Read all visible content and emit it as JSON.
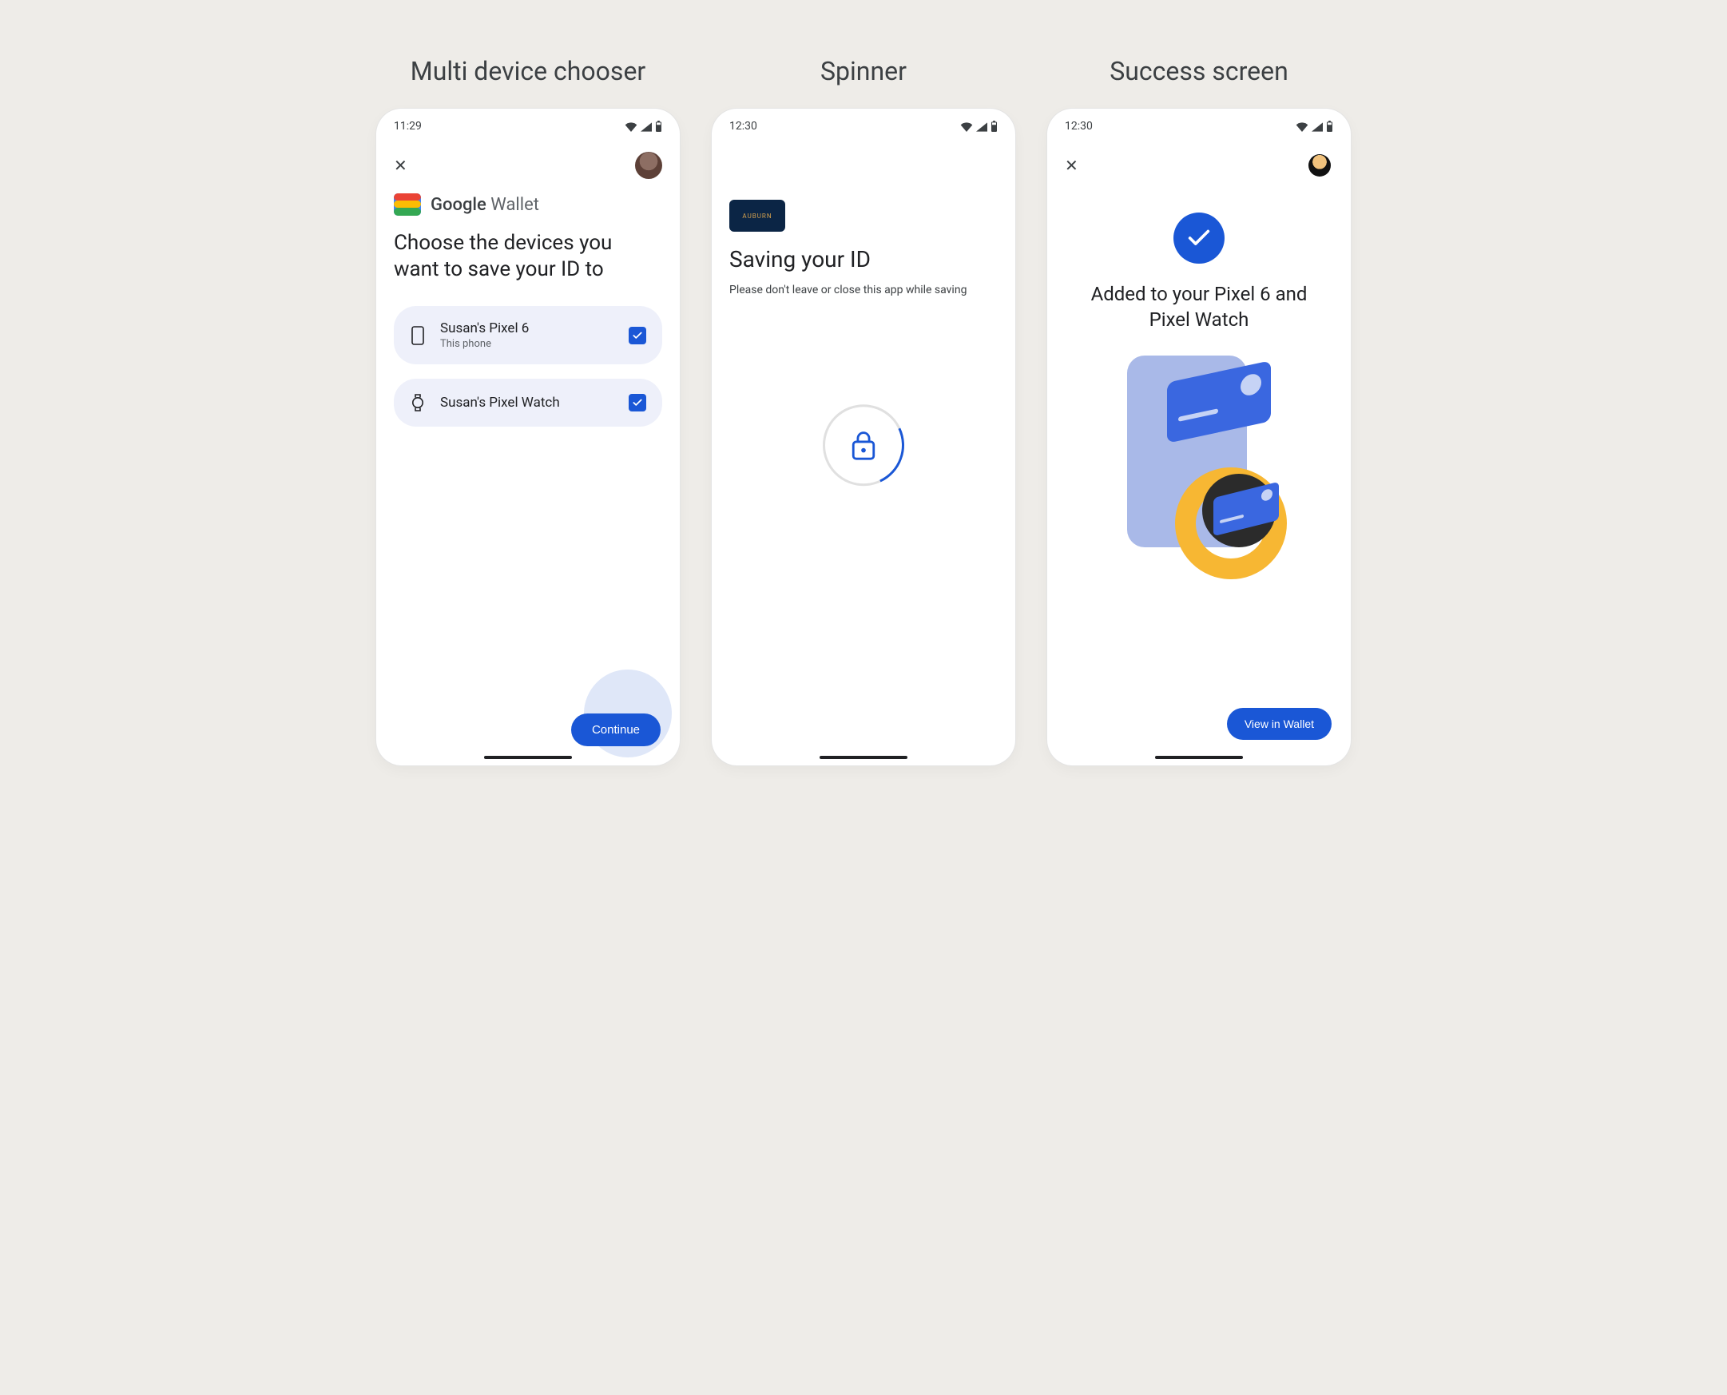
{
  "columns": {
    "chooser": {
      "title": "Multi device chooser"
    },
    "spinner": {
      "title": "Spinner"
    },
    "success": {
      "title": "Success screen"
    }
  },
  "screen1": {
    "status_time": "11:29",
    "brand_strong": "Google",
    "brand_light": " Wallet",
    "headline": "Choose the devices you want to save your ID to",
    "devices": [
      {
        "name": "Susan's Pixel 6",
        "sub": "This phone",
        "icon": "phone",
        "checked": true
      },
      {
        "name": "Susan's Pixel Watch",
        "sub": "",
        "icon": "watch",
        "checked": true
      }
    ],
    "cta": "Continue"
  },
  "screen2": {
    "status_time": "12:30",
    "issuer_label": "AUBURN",
    "headline": "Saving your ID",
    "subline": "Please don't leave or close this app while saving"
  },
  "screen3": {
    "status_time": "12:30",
    "headline": "Added to your Pixel 6 and Pixel Watch",
    "cta": "View in Wallet"
  }
}
